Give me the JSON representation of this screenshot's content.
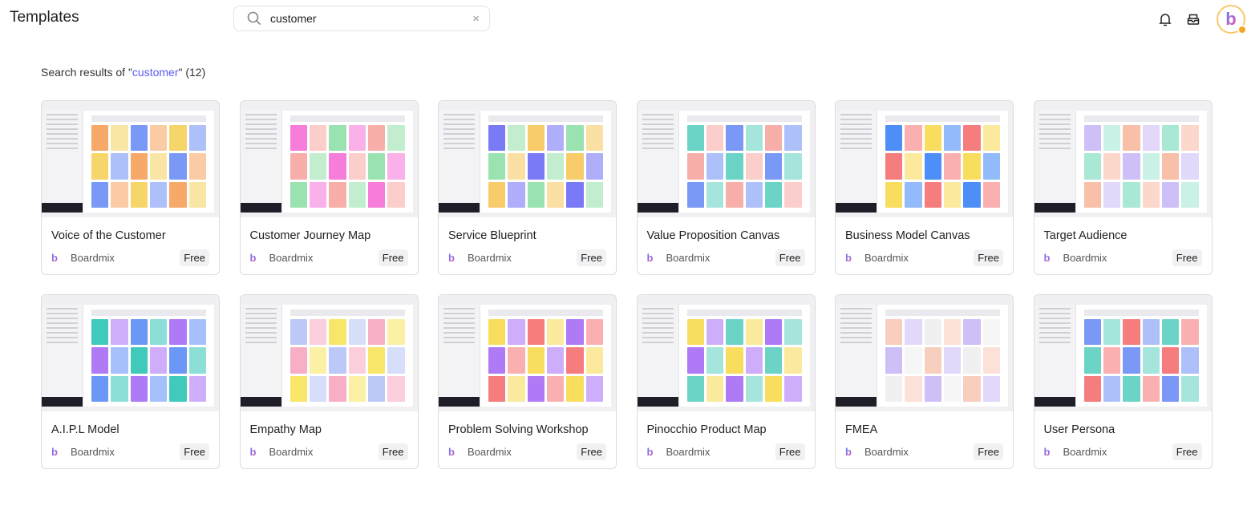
{
  "header": {
    "title": "Templates",
    "search_value": "customer",
    "clear_icon": "×"
  },
  "results": {
    "prefix": "Search results of \"",
    "query": "customer",
    "suffix": "\" (12)"
  },
  "templates": [
    {
      "name": "Voice of the Customer",
      "author": "Boardmix",
      "price": "Free",
      "colors": [
        "#f6a05a",
        "#f5d15a",
        "#6b8df5"
      ]
    },
    {
      "name": "Customer Journey Map",
      "author": "Boardmix",
      "price": "Free",
      "colors": [
        "#f56fd6",
        "#f7a6a0",
        "#8fe0a8"
      ]
    },
    {
      "name": "Service Blueprint",
      "author": "Boardmix",
      "price": "Free",
      "colors": [
        "#6b6bf5",
        "#8fe0a8",
        "#f7c65a"
      ]
    },
    {
      "name": "Value Proposition Canvas",
      "author": "Boardmix",
      "price": "Free",
      "colors": [
        "#5ccfc0",
        "#f7a6a0",
        "#6b8df5"
      ]
    },
    {
      "name": "Business Model Canvas",
      "author": "Boardmix",
      "price": "Free",
      "colors": [
        "#3b82f6",
        "#f56f6f",
        "#f7d94c"
      ]
    },
    {
      "name": "Target Audience",
      "author": "Boardmix",
      "price": "Free",
      "colors": [
        "#c9b8f5",
        "#9ee6cf",
        "#f7b8a0"
      ]
    },
    {
      "name": "A.I.P.L Model",
      "author": "Boardmix",
      "price": "Free",
      "colors": [
        "#2bc4b4",
        "#a56cf5",
        "#5b8df5"
      ]
    },
    {
      "name": "Empathy Map",
      "author": "Boardmix",
      "price": "Free",
      "colors": [
        "#b5c3f5",
        "#f7a6c0",
        "#f7e35a"
      ]
    },
    {
      "name": "Problem Solving Workshop",
      "author": "Boardmix",
      "price": "Free",
      "colors": [
        "#f7d94c",
        "#a56cf5",
        "#f56f6f"
      ]
    },
    {
      "name": "Pinocchio Product Map",
      "author": "Boardmix",
      "price": "Free",
      "colors": [
        "#f7d94c",
        "#a56cf5",
        "#5ccfc0"
      ]
    },
    {
      "name": "FMEA",
      "author": "Boardmix",
      "price": "Free",
      "colors": [
        "#f7c9b8",
        "#c9b8f5",
        "#eeeeee"
      ]
    },
    {
      "name": "User Persona",
      "author": "Boardmix",
      "price": "Free",
      "colors": [
        "#6b8df5",
        "#5ccfc0",
        "#f56f6f"
      ]
    }
  ]
}
